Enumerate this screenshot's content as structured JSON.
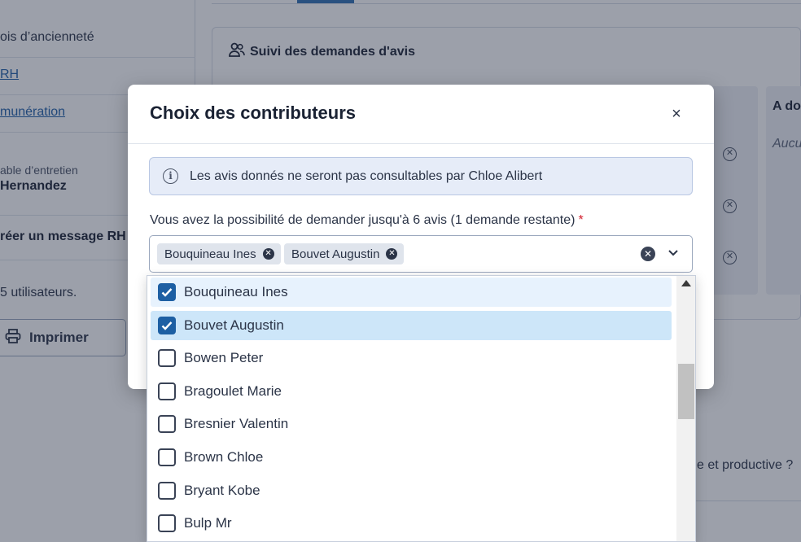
{
  "sidebar": {
    "rows": [
      {
        "text": "ois d’ancienneté",
        "kind": "text"
      },
      {
        "text": "RH",
        "kind": "link"
      },
      {
        "text": "munération",
        "kind": "link"
      }
    ],
    "interviewer_label": "able d’entretien",
    "interviewer_name": "Hernandez",
    "create_message": "réer un message RH",
    "users_count": "5 utilisateurs.",
    "print_label": "Imprimer"
  },
  "main": {
    "card_title": "Suivi des demandes d'avis",
    "column_title": "A do",
    "column_empty": "Aucu",
    "question_fragment": "e et productive ?"
  },
  "modal": {
    "title": "Choix des contributeurs",
    "close_symbol": "×",
    "info_text": "Les avis donnés ne seront pas consultables par Chloe Alibert",
    "field_label": "Vous avez la possibilité de demander jusqu'à 6 avis (1 demande restante)",
    "required_mark": "*",
    "selected_chips": [
      "Bouquineau Ines",
      "Bouvet Augustin"
    ],
    "options": [
      {
        "label": "Bouquineau Ines",
        "checked": true,
        "state": "selected"
      },
      {
        "label": "Bouvet Augustin",
        "checked": true,
        "state": "focused"
      },
      {
        "label": "Bowen Peter",
        "checked": false,
        "state": ""
      },
      {
        "label": "Bragoulet Marie",
        "checked": false,
        "state": ""
      },
      {
        "label": "Bresnier Valentin",
        "checked": false,
        "state": ""
      },
      {
        "label": "Brown Chloe",
        "checked": false,
        "state": ""
      },
      {
        "label": "Bryant Kobe",
        "checked": false,
        "state": ""
      },
      {
        "label": "Bulp Mr",
        "checked": false,
        "state": ""
      }
    ]
  },
  "colors": {
    "overlay": "#232d42",
    "accent": "#1d5fa3",
    "required": "#d21d2c",
    "option_selected": "#e7f2fd",
    "option_focused": "#cde6f9"
  }
}
